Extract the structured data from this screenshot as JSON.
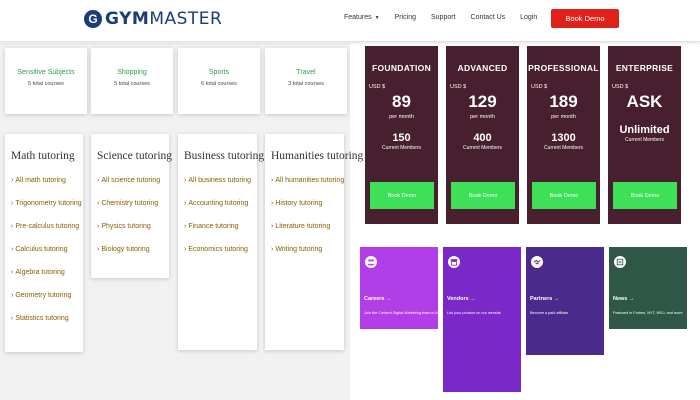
{
  "header": {
    "logo_icon": "G",
    "logo_bold": "GYM",
    "logo_rest": "MASTER",
    "nav": [
      "Features",
      "Pricing",
      "Support",
      "Contact Us",
      "Login"
    ],
    "cta": "Book Demo"
  },
  "categories": [
    {
      "title": "Sensitive Subjects",
      "count": "5 total courses"
    },
    {
      "title": "Shopping",
      "count": "5 total courses"
    },
    {
      "title": "Sports",
      "count": "6 total courses"
    },
    {
      "title": "Travel",
      "count": "3 total courses"
    }
  ],
  "subjects": [
    {
      "title": "Math tutoring",
      "links": [
        "All math tutoring",
        "Trigonometry tutoring",
        "Pre-calculus tutoring",
        "Calculus tutoring",
        "Algebra tutoring",
        "Geometry tutoring",
        "Statistics tutoring"
      ]
    },
    {
      "title": "Science tutoring",
      "links": [
        "All science tutoring",
        "Chemistry tutoring",
        "Physics tutoring",
        "Biology tutoring"
      ]
    },
    {
      "title": "Business tutoring",
      "links": [
        "All business tutoring",
        "Accounting tutoring",
        "Finance tutoring",
        "Economics tutoring"
      ]
    },
    {
      "title": "Humanities tutoring",
      "links": [
        "All humanities tutoring",
        "History tutoring",
        "Literature tutoring",
        "Writing tutoring"
      ]
    }
  ],
  "plans": [
    {
      "name": "FOUNDATION",
      "currency": "USD $",
      "price": "89",
      "per": "per month",
      "members": "150",
      "members_label": "Current Members",
      "cta": "Book Demo"
    },
    {
      "name": "ADVANCED",
      "currency": "USD $",
      "price": "129",
      "per": "per month",
      "members": "400",
      "members_label": "Current Members",
      "cta": "Book Demo"
    },
    {
      "name": "PROFESSIONAL",
      "currency": "USD $",
      "price": "189",
      "per": "per month",
      "members": "1300",
      "members_label": "Current Members",
      "cta": "Book Demo"
    },
    {
      "name": "ENTERPRISE",
      "currency": "USD $",
      "price": "ASK",
      "per": "",
      "members": "Unlimited",
      "members_label": "Current Members",
      "cta": "Book Demo"
    }
  ],
  "tiles": [
    {
      "title": "Careers",
      "arrow": "→",
      "desc": "Join the Content Digital Marketing team in Austin",
      "color": "#b23ee8",
      "icon": "people-icon"
    },
    {
      "title": "Vendors",
      "arrow": "→",
      "desc": "List your product on our website",
      "color": "#7a28c8",
      "icon": "store-icon"
    },
    {
      "title": "Partners",
      "arrow": "→",
      "desc": "Become a paid affiliate",
      "color": "#4a2a8a",
      "icon": "handshake-icon"
    },
    {
      "title": "News",
      "arrow": "→",
      "desc": "Featured in Forbes, NYT, WSJ, and more",
      "color": "#2f5747",
      "icon": "newspaper-icon"
    }
  ],
  "colors": {
    "brand": "#1a3c78",
    "cta": "#e0201a",
    "plan_bg": "#471f2e",
    "plan_button": "#3ee058",
    "category_title": "#2f9e45",
    "subject_link": "#8a5c00"
  }
}
